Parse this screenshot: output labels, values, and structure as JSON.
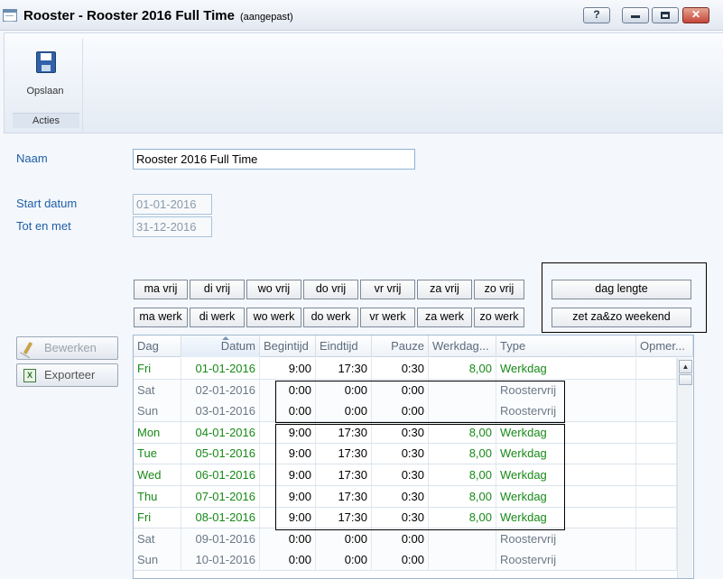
{
  "window": {
    "title": "Rooster - Rooster 2016 Full Time",
    "subtitle": "(aangepast)",
    "help_glyph": "?",
    "close_glyph": "✕"
  },
  "ribbon": {
    "save_label": "Opslaan",
    "group_label": "Acties"
  },
  "form": {
    "naam_label": "Naam",
    "naam_value": "Rooster 2016 Full Time",
    "start_label": "Start datum",
    "start_value": "01-01-2016",
    "end_label": "Tot en met",
    "end_value": "31-12-2016"
  },
  "day_buttons": {
    "vrij": [
      "ma vrij",
      "di vrij",
      "wo vrij",
      "do vrij",
      "vr vrij",
      "za vrij",
      "zo vrij"
    ],
    "werk": [
      "ma werk",
      "di werk",
      "wo werk",
      "do werk",
      "vr werk",
      "za werk",
      "zo werk"
    ]
  },
  "actions": {
    "dag_lengte": "dag lengte",
    "weekend": "zet za&zo weekend",
    "bewerken": "Bewerken",
    "exporteer": "Exporteer"
  },
  "grid": {
    "columns": [
      "Dag",
      "Datum",
      "Begintijd",
      "Eindtijd",
      "Pauze",
      "Werkdag...",
      "Type",
      "Opmer..."
    ],
    "rows": [
      {
        "dag": "Fri",
        "datum": "01-01-2016",
        "begin": "9:00",
        "eind": "17:30",
        "pauze": "0:30",
        "werkdag": "8,00",
        "type": "Werkdag",
        "kind": "work"
      },
      {
        "dag": "Sat",
        "datum": "02-01-2016",
        "begin": "0:00",
        "eind": "0:00",
        "pauze": "0:00",
        "werkdag": "",
        "type": "Roostervrij",
        "kind": "free"
      },
      {
        "dag": "Sun",
        "datum": "03-01-2016",
        "begin": "0:00",
        "eind": "0:00",
        "pauze": "0:00",
        "werkdag": "",
        "type": "Roostervrij",
        "kind": "free"
      },
      {
        "dag": "Mon",
        "datum": "04-01-2016",
        "begin": "9:00",
        "eind": "17:30",
        "pauze": "0:30",
        "werkdag": "8,00",
        "type": "Werkdag",
        "kind": "work"
      },
      {
        "dag": "Tue",
        "datum": "05-01-2016",
        "begin": "9:00",
        "eind": "17:30",
        "pauze": "0:30",
        "werkdag": "8,00",
        "type": "Werkdag",
        "kind": "work"
      },
      {
        "dag": "Wed",
        "datum": "06-01-2016",
        "begin": "9:00",
        "eind": "17:30",
        "pauze": "0:30",
        "werkdag": "8,00",
        "type": "Werkdag",
        "kind": "work"
      },
      {
        "dag": "Thu",
        "datum": "07-01-2016",
        "begin": "9:00",
        "eind": "17:30",
        "pauze": "0:30",
        "werkdag": "8,00",
        "type": "Werkdag",
        "kind": "work"
      },
      {
        "dag": "Fri",
        "datum": "08-01-2016",
        "begin": "9:00",
        "eind": "17:30",
        "pauze": "0:30",
        "werkdag": "8,00",
        "type": "Werkdag",
        "kind": "work"
      },
      {
        "dag": "Sat",
        "datum": "09-01-2016",
        "begin": "0:00",
        "eind": "0:00",
        "pauze": "0:00",
        "werkdag": "",
        "type": "Roostervrij",
        "kind": "free"
      },
      {
        "dag": "Sun",
        "datum": "10-01-2016",
        "begin": "0:00",
        "eind": "0:00",
        "pauze": "0:00",
        "werkdag": "",
        "type": "Roostervrij",
        "kind": "free"
      }
    ]
  },
  "colors": {
    "work_text": "#178a17",
    "free_text": "#6b7888",
    "label_blue": "#1e5fa8"
  }
}
